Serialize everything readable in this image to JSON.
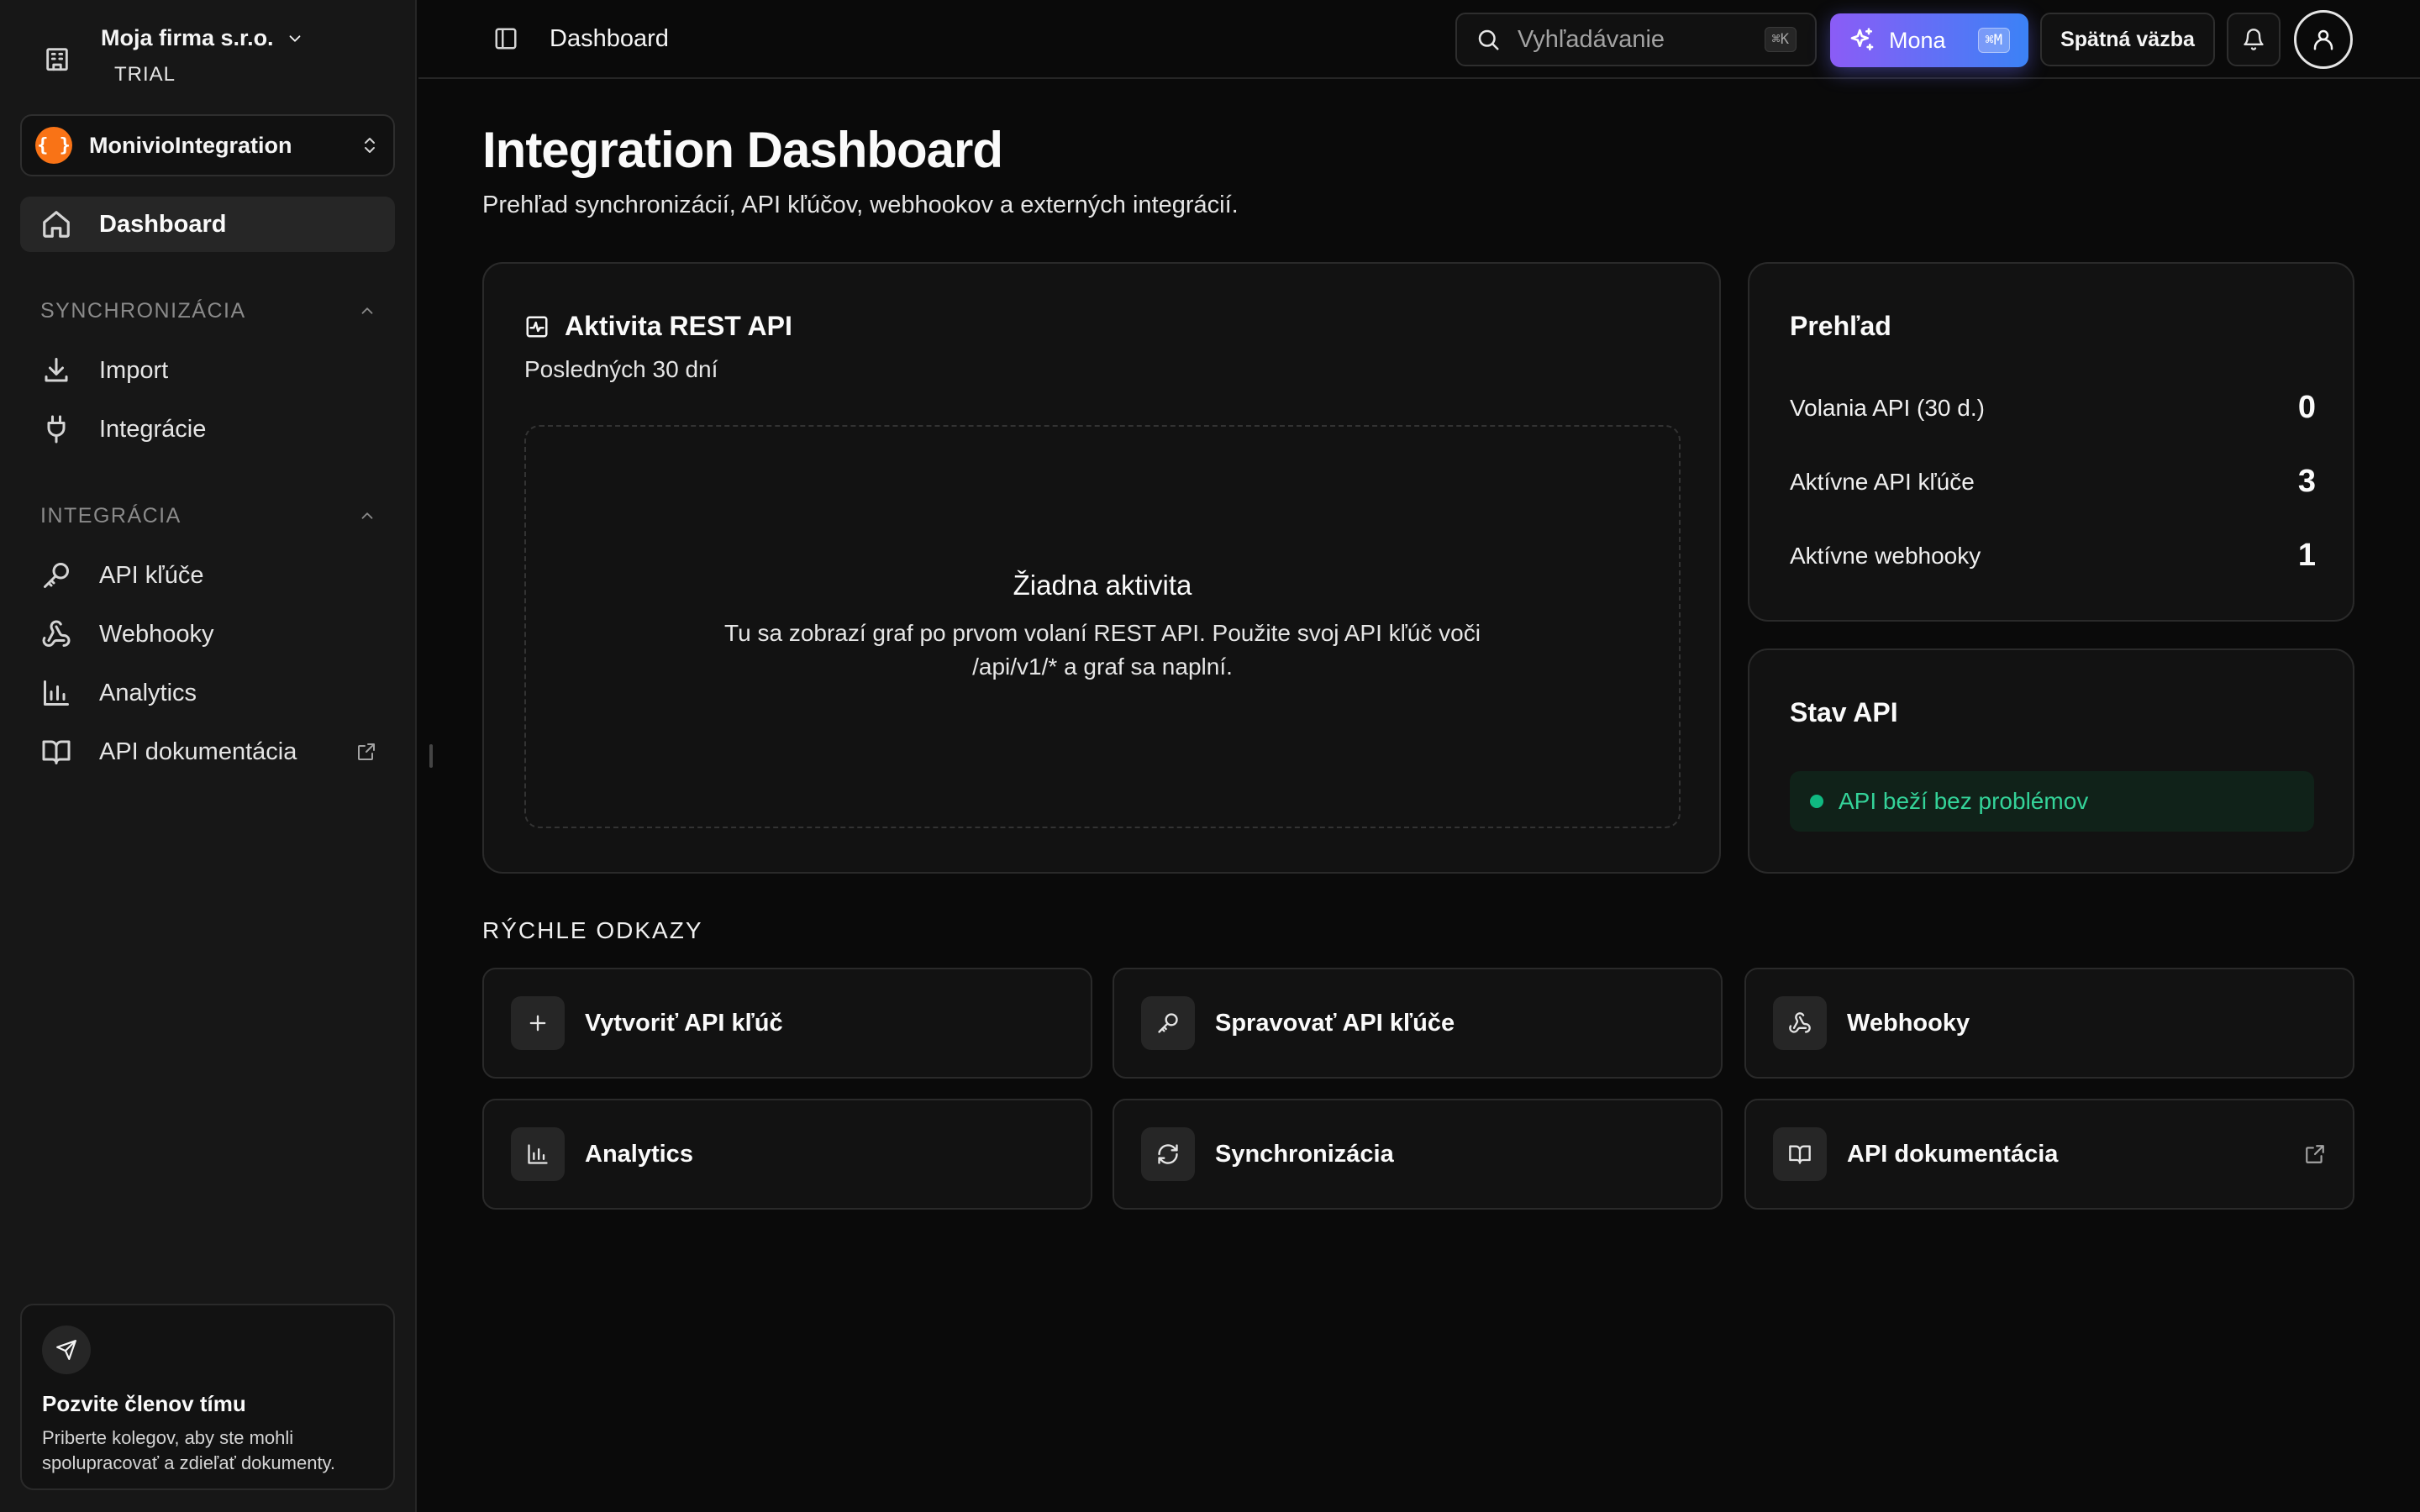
{
  "org": {
    "name": "Moja firma s.r.o.",
    "plan": "TRIAL"
  },
  "project": {
    "logo": "{ }",
    "name": "MonivioIntegration"
  },
  "sidebar": {
    "dashboard": "Dashboard",
    "sync_section": "SYNCHRONIZÁCIA",
    "import": "Import",
    "integrations": "Integrácie",
    "integration_section": "INTEGRÁCIA",
    "api_keys": "API kľúče",
    "webhooks": "Webhooky",
    "analytics": "Analytics",
    "api_docs": "API dokumentácia"
  },
  "invite": {
    "title": "Pozvite členov tímu",
    "desc": "Priberte kolegov, aby ste mohli spolupracovať a zdieľať dokumenty."
  },
  "header": {
    "breadcrumb": "Dashboard",
    "search_placeholder": "Vyhľadávanie",
    "search_kbd": "⌘K",
    "mona_label": "Mona",
    "mona_kbd": "⌘M",
    "feedback": "Spätná väzba"
  },
  "page": {
    "title": "Integration Dashboard",
    "subtitle": "Prehľad synchronizácií, API kľúčov, webhookov a externých integrácií."
  },
  "activity": {
    "title": "Aktivita REST API",
    "period": "Posledných 30 dní",
    "empty_title": "Žiadna aktivita",
    "empty_desc": "Tu sa zobrazí graf po prvom volaní REST API. Použite svoj API kľúč voči /api/v1/* a graf sa naplní."
  },
  "overview": {
    "title": "Prehľad",
    "stats": [
      {
        "label": "Volania API (30 d.)",
        "value": "0"
      },
      {
        "label": "Aktívne API kľúče",
        "value": "3"
      },
      {
        "label": "Aktívne webhooky",
        "value": "1"
      }
    ]
  },
  "api_status": {
    "title": "Stav API",
    "status": "API beží bez problémov",
    "status_color": "#10b981"
  },
  "quick_links": {
    "title": "RÝCHLE ODKAZY",
    "items": [
      {
        "label": "Vytvoriť API kľúč",
        "icon": "plus-icon"
      },
      {
        "label": "Spravovať API kľúče",
        "icon": "key-icon"
      },
      {
        "label": "Webhooky",
        "icon": "webhook-icon"
      },
      {
        "label": "Analytics",
        "icon": "bar-chart-icon"
      },
      {
        "label": "Synchronizácia",
        "icon": "refresh-icon"
      },
      {
        "label": "API dokumentácia",
        "icon": "book-icon"
      }
    ]
  },
  "colors": {
    "accent_start": "#8b5cf6",
    "accent_end": "#3b82f6",
    "project_logo": "#f97316",
    "success": "#34d399"
  }
}
